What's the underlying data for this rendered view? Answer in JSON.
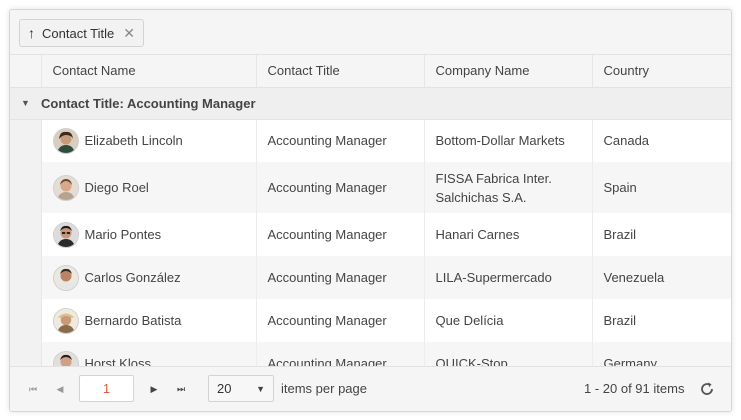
{
  "grouping": {
    "chip_label": "Contact Title",
    "sort_icon": "arrow-up-icon",
    "remove_icon": "close-icon"
  },
  "columns": [
    "Contact Name",
    "Contact Title",
    "Company Name",
    "Country"
  ],
  "group": {
    "label": "Contact Title: Accounting Manager",
    "toggle_icon": "triangle-down-icon"
  },
  "rows": [
    {
      "name": "Elizabeth Lincoln",
      "title": "Accounting Manager",
      "company_line1": "Bottom-Dollar Markets",
      "company_line2": "",
      "country": "Canada"
    },
    {
      "name": "Diego Roel",
      "title": "Accounting Manager",
      "company_line1": "FISSA Fabrica Inter.",
      "company_line2": "Salchichas S.A.",
      "country": "Spain"
    },
    {
      "name": "Mario Pontes",
      "title": "Accounting Manager",
      "company_line1": "Hanari Carnes",
      "company_line2": "",
      "country": "Brazil"
    },
    {
      "name": "Carlos González",
      "title": "Accounting Manager",
      "company_line1": "LILA-Supermercado",
      "company_line2": "",
      "country": "Venezuela"
    },
    {
      "name": "Bernardo Batista",
      "title": "Accounting Manager",
      "company_line1": "Que Delícia",
      "company_line2": "",
      "country": "Brazil"
    },
    {
      "name": "Horst Kloss",
      "title": "Accounting Manager",
      "company_line1": "QUICK-Stop",
      "company_line2": "",
      "country": "Germany"
    }
  ],
  "pager": {
    "current_page": "1",
    "page_size": "20",
    "items_per_page_label": "items per page",
    "range_text": "1 - 20 of 91 items"
  },
  "colors": {
    "accent": "#e05a3e",
    "header_bg": "#f5f5f5",
    "group_bg": "#efefef"
  }
}
